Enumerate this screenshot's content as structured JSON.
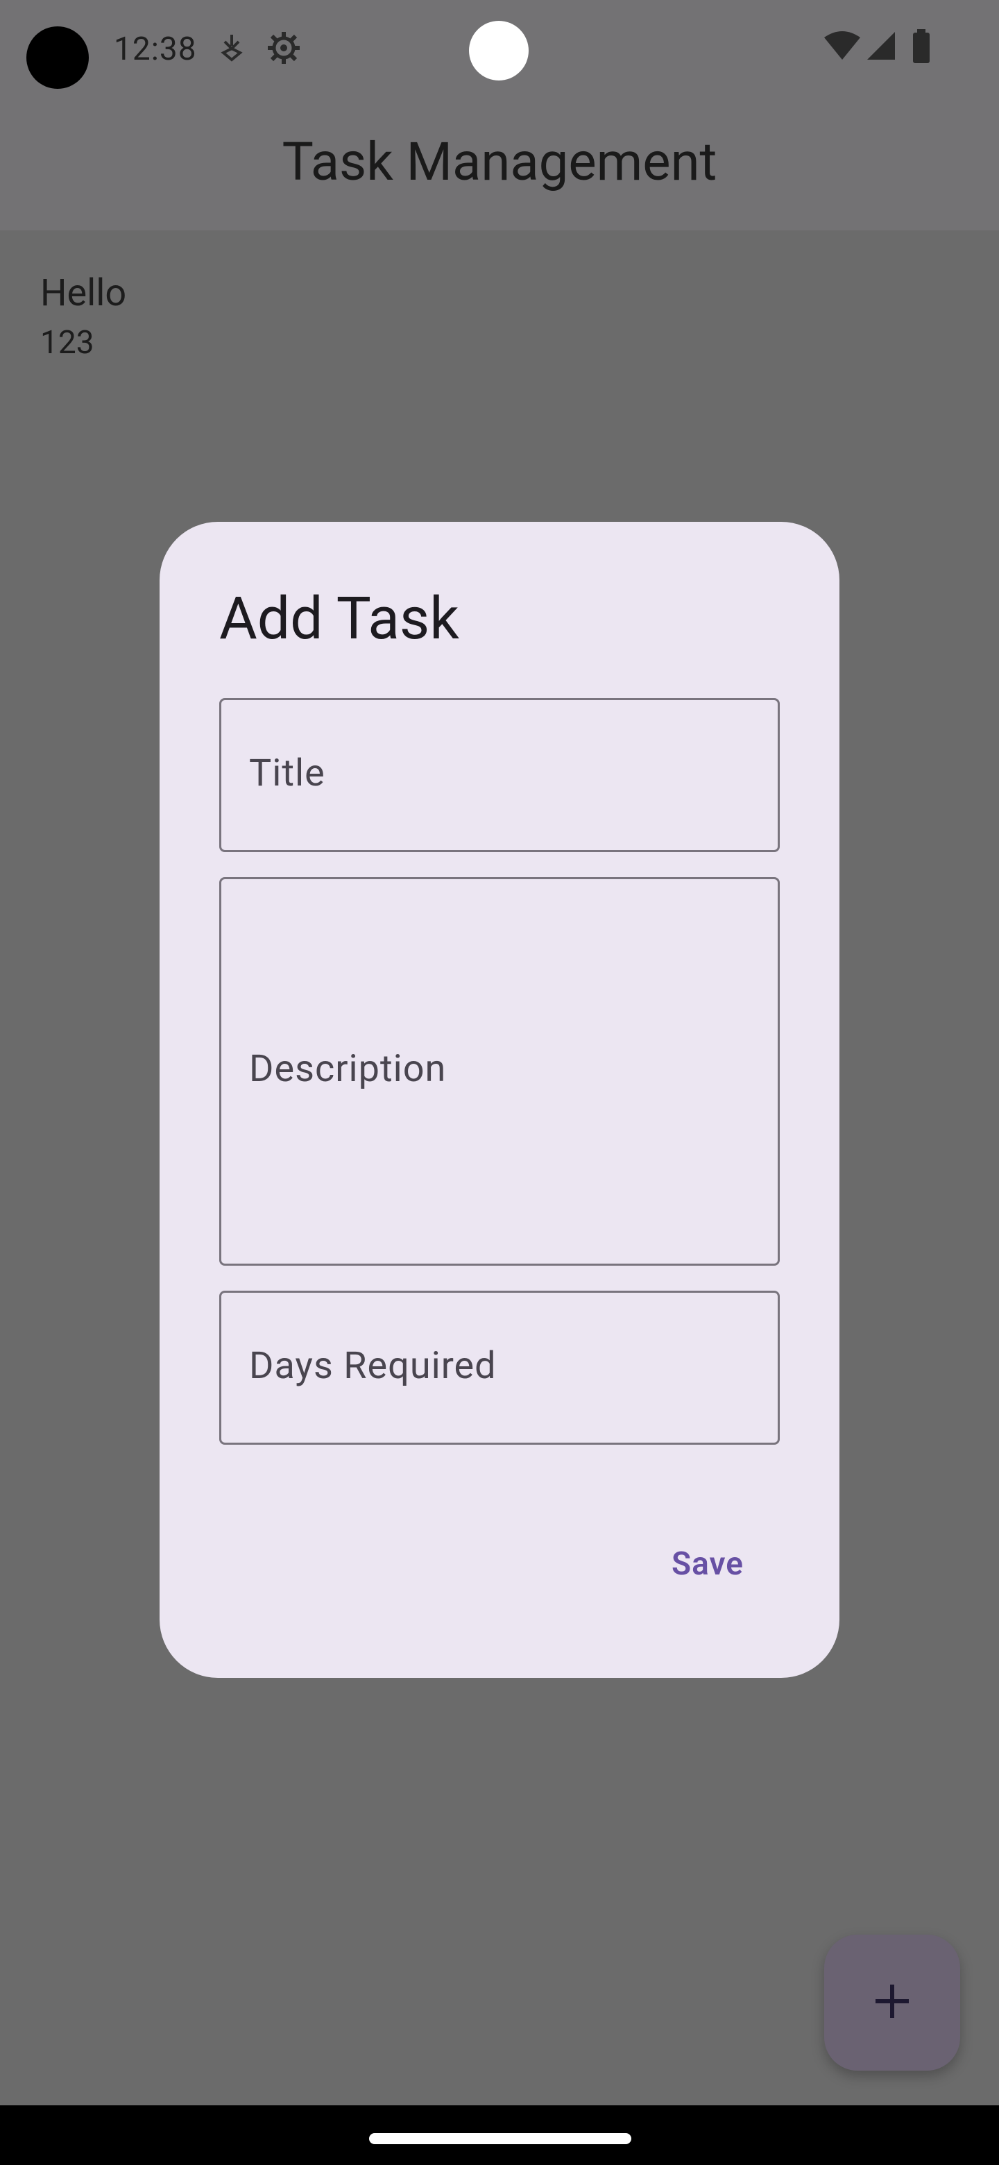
{
  "status_bar": {
    "time": "12:38",
    "icons_left": [
      "location-download-icon",
      "settings-gear-icon"
    ],
    "icons_right": [
      "wifi-icon",
      "cellular-signal-icon",
      "battery-icon"
    ]
  },
  "app_bar": {
    "title": "Task Management"
  },
  "tasks": [
    {
      "title": "Hello",
      "subtitle": "123"
    }
  ],
  "dialog": {
    "title": "Add Task",
    "fields": {
      "title": {
        "label": "Title",
        "value": ""
      },
      "description": {
        "label": "Description",
        "value": ""
      },
      "days_required": {
        "label": "Days Required",
        "value": ""
      }
    },
    "save_label": "Save"
  },
  "fab": {
    "icon": "plus-icon"
  },
  "colors": {
    "scrim_background": "#6b6b6b",
    "dialog_surface": "#ece6f2",
    "primary": "#6750a4",
    "outline": "#79747e"
  }
}
